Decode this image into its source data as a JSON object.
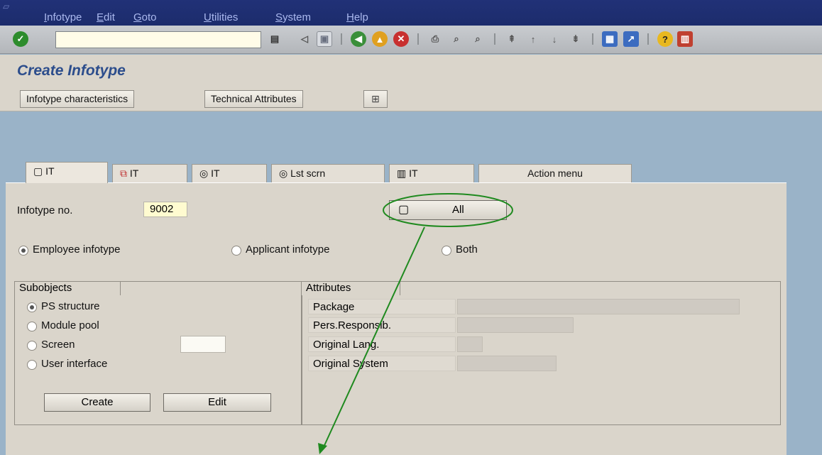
{
  "menu": [
    "Infotype",
    "Edit",
    "Goto",
    "Utilities",
    "System",
    "Help"
  ],
  "command_field": {
    "value": ""
  },
  "title": "Create Infotype",
  "app_toolbar": {
    "characteristics": "Infotype characteristics",
    "technical": "Technical Attributes"
  },
  "tabs": [
    "IT",
    "IT",
    "IT",
    "Lst scrn",
    "IT",
    "Action menu"
  ],
  "form": {
    "infotype_label": "Infotype no.",
    "infotype_value": "9002",
    "all_button": "All",
    "radio_employee": "Employee infotype",
    "radio_applicant": "Applicant infotype",
    "radio_both": "Both"
  },
  "subobjects": {
    "title": "Subobjects",
    "options": [
      "PS structure",
      "Module pool",
      "Screen",
      "User interface"
    ],
    "create": "Create",
    "edit": "Edit"
  },
  "attributes": {
    "title": "Attributes",
    "fields": [
      "Package",
      "Pers.Responsib.",
      "Original Lang.",
      "Original System"
    ]
  },
  "colors": {
    "title": "#2c4d8c",
    "annotation": "#1f8a1f",
    "menubar": "#213177"
  }
}
